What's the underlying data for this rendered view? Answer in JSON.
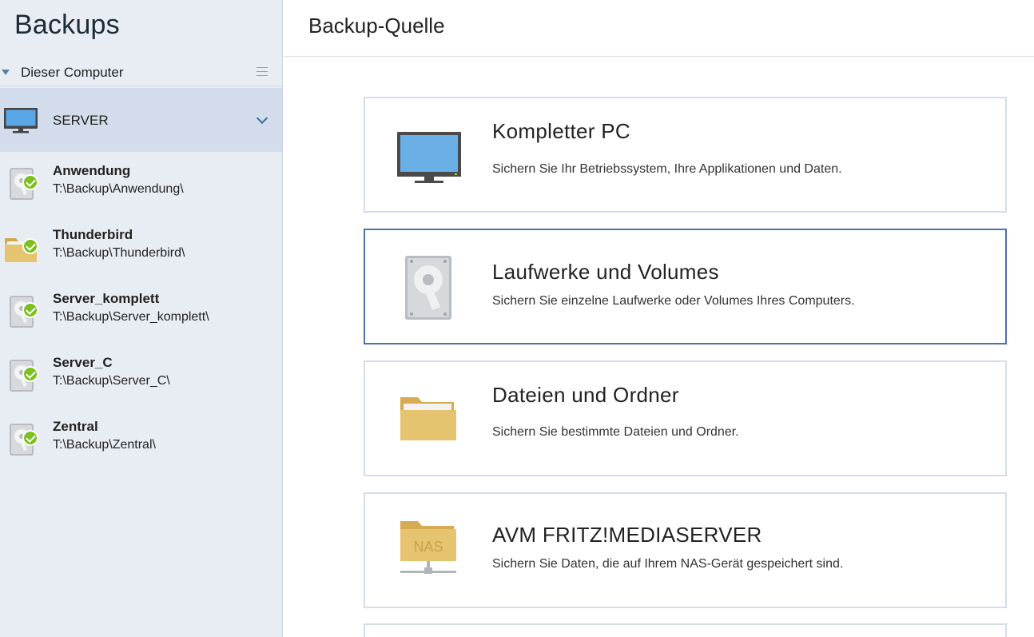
{
  "sidebar": {
    "title": "Backups",
    "group_label": "Dieser Computer",
    "server_label": "SERVER",
    "items": [
      {
        "name": "Anwendung",
        "path": "T:\\Backup\\Anwendung\\",
        "icon": "drive-icon"
      },
      {
        "name": "Thunderbird",
        "path": "T:\\Backup\\Thunderbird\\",
        "icon": "folder-icon"
      },
      {
        "name": "Server_komplett",
        "path": "T:\\Backup\\Server_komplett\\",
        "icon": "drive-icon"
      },
      {
        "name": "Server_C",
        "path": "T:\\Backup\\Server_C\\",
        "icon": "drive-icon"
      },
      {
        "name": "Zentral",
        "path": "T:\\Backup\\Zentral\\",
        "icon": "drive-icon"
      }
    ]
  },
  "main": {
    "title": "Backup-Quelle",
    "cards": [
      {
        "title": "Kompletter PC",
        "desc": "Sichern Sie Ihr Betriebssystem, Ihre Applikationen und Daten.",
        "icon": "monitor-icon"
      },
      {
        "title": "Laufwerke und Volumes",
        "desc": "Sichern Sie einzelne Laufwerke oder Volumes Ihres Computers.",
        "icon": "hard-drive-icon"
      },
      {
        "title": "Dateien und Ordner",
        "desc": "Sichern Sie bestimmte Dateien und Ordner.",
        "icon": "folder-icon"
      },
      {
        "title": "AVM FRITZ!MEDIASERVER",
        "desc": "Sichern Sie Daten, die auf Ihrem NAS-Gerät gespeichert sind.",
        "icon": "nas-folder-icon",
        "badge": "NAS"
      }
    ]
  },
  "colors": {
    "sidebar_bg": "#e8edf4",
    "selected_row": "#d3dceb",
    "accent": "#4a73a8",
    "success": "#7cbf1e",
    "folder": "#e4c06d"
  }
}
